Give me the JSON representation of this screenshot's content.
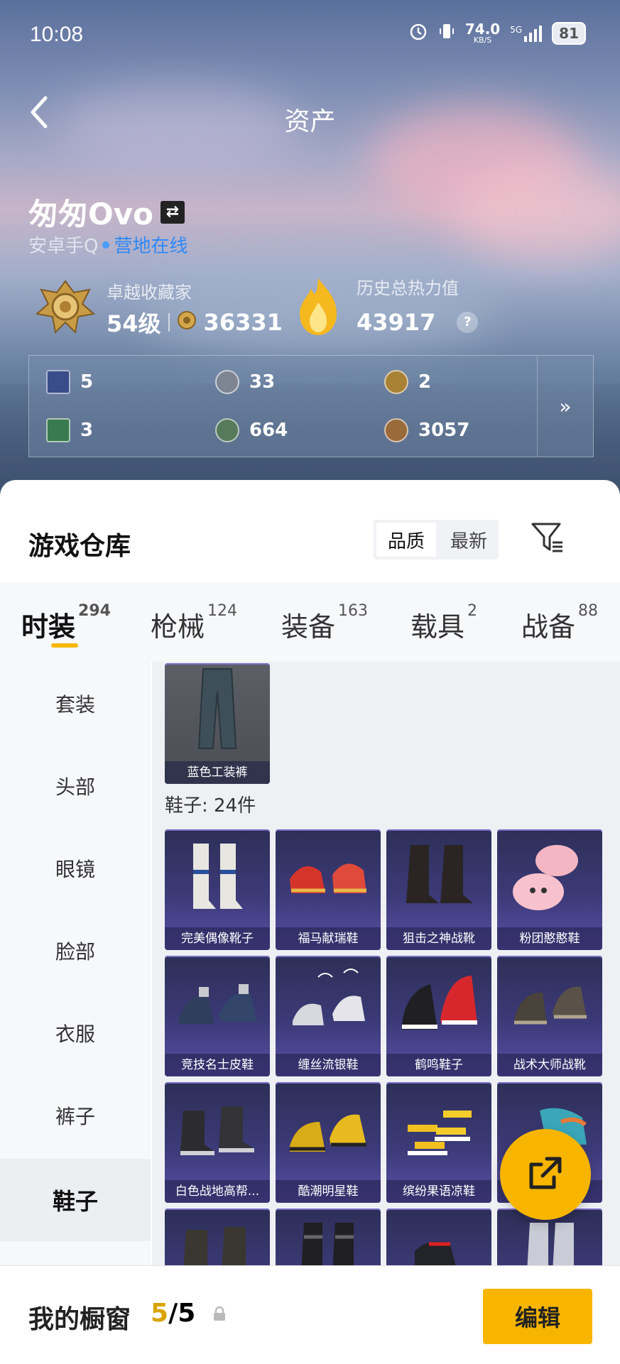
{
  "status": {
    "time": "10:08",
    "net_speed": "74.0",
    "net_unit": "KB/S",
    "signal": "5G",
    "battery": "81"
  },
  "header": {
    "title": "资产"
  },
  "player": {
    "name": "匆匆Ovo",
    "platform": "安卓手Q",
    "status": "营地在线",
    "collector_label": "卓越收藏家",
    "level": "54级",
    "coins": "36331",
    "heat_label": "历史总热力值",
    "heat_value": "43917",
    "help": "?"
  },
  "counts": [
    {
      "value": "5",
      "icon": "card-icon"
    },
    {
      "value": "33",
      "icon": "silver-coin-icon"
    },
    {
      "value": "2",
      "icon": "gold-badge-icon"
    },
    {
      "value": "3",
      "icon": "green-card-icon"
    },
    {
      "value": "664",
      "icon": "green-coin-icon"
    },
    {
      "value": "3057",
      "icon": "bronze-coin-icon"
    }
  ],
  "more": "»",
  "warehouse": {
    "title": "游戏仓库",
    "sort_options": [
      "品质",
      "最新"
    ],
    "tabs": [
      {
        "label": "时装",
        "count": "294"
      },
      {
        "label": "枪械",
        "count": "124"
      },
      {
        "label": "装备",
        "count": "163"
      },
      {
        "label": "载具",
        "count": "2"
      },
      {
        "label": "战备",
        "count": "88"
      }
    ],
    "side": [
      "套装",
      "头部",
      "眼镜",
      "脸部",
      "衣服",
      "裤子",
      "鞋子"
    ],
    "top_item": "蓝色工装裤",
    "section": "鞋子: 24件",
    "items": [
      "完美偶像靴子",
      "福马献瑞鞋",
      "狙击之神战靴",
      "粉团憨憨鞋",
      "竞技名士皮鞋",
      "缠丝流银鞋",
      "鹤鸣鞋子",
      "战术大师战靴",
      "白色战地高帮...",
      "酷潮明星鞋",
      "缤纷果语凉鞋",
      "鞋"
    ]
  },
  "bottom": {
    "label": "我的橱窗",
    "current": "5",
    "total": "/5",
    "edit": "编辑"
  },
  "colors": {
    "accent": "#f7b500",
    "online": "#2e88f5",
    "card_purple": "#3c3a78"
  }
}
